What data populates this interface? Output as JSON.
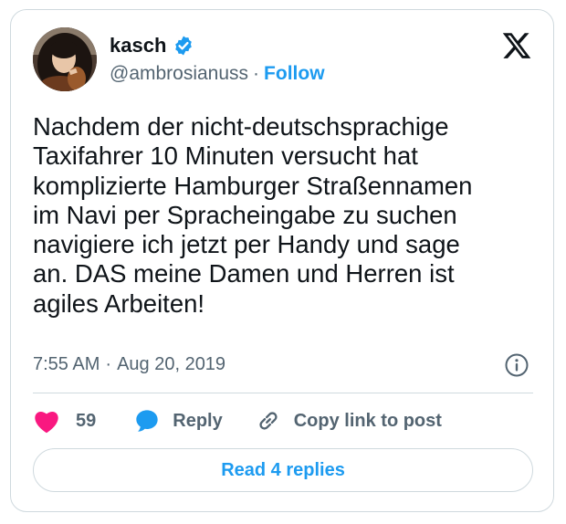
{
  "author": {
    "name": "kasch",
    "handle": "@ambrosianuss",
    "verified": true,
    "follow_label": "Follow",
    "separator": "·"
  },
  "tweet": {
    "text": "Nachdem der nicht-deutschsprachige\nTaxifahrer 10 Minuten versucht hat\nkomplizierte Hamburger Straßennamen\nim Navi per Spracheingabe zu suchen\nnavigiere ich jetzt per Handy und sage\nan. DAS meine Damen und Herren ist\nagiles Arbeiten!",
    "time": "7:55 AM",
    "separator": "·",
    "date": "Aug 20, 2019"
  },
  "actions": {
    "likes_count": "59",
    "reply_label": "Reply",
    "copy_link_label": "Copy link to post"
  },
  "read_replies_label": "Read 4 replies",
  "icons": {
    "logo": "x-logo-icon",
    "verified": "verified-badge-icon",
    "info": "info-icon",
    "like": "heart-icon",
    "reply": "speech-bubble-icon",
    "link": "link-icon"
  },
  "colors": {
    "accent": "#1d9bf0",
    "like": "#f91880",
    "text": "#0f1419",
    "secondary": "#536471",
    "border": "#cfd9de"
  }
}
